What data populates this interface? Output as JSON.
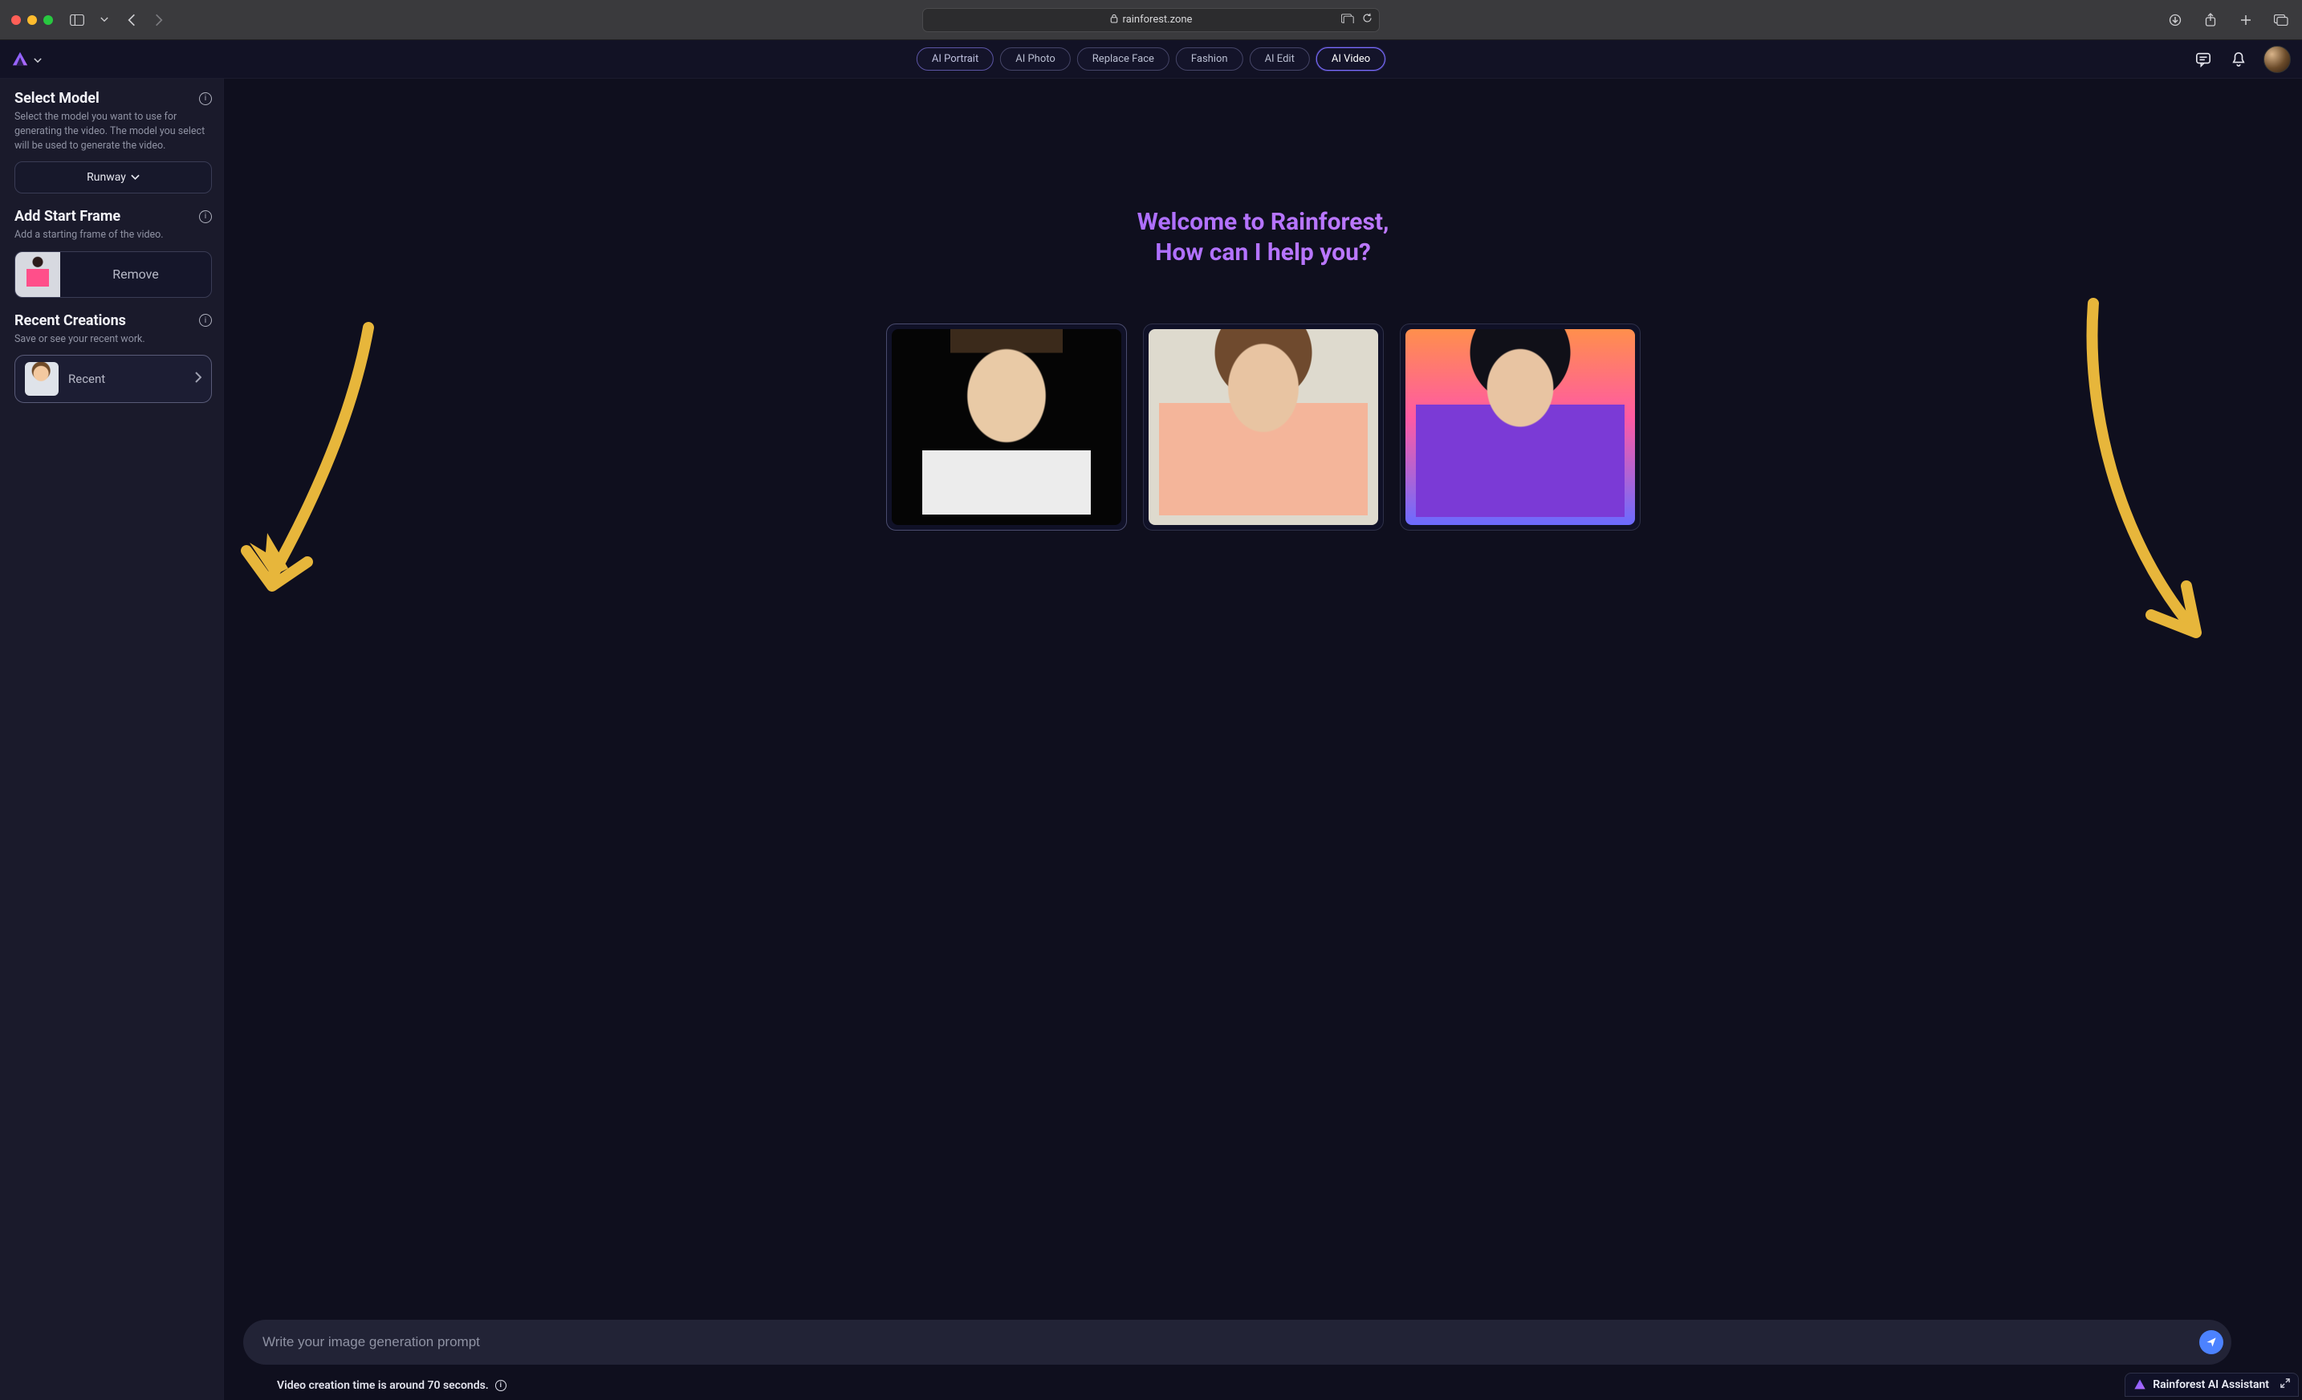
{
  "browser": {
    "url": "rainforest.zone"
  },
  "header": {
    "tabs": [
      {
        "label": "AI Portrait"
      },
      {
        "label": "AI Photo"
      },
      {
        "label": "Replace Face"
      },
      {
        "label": "Fashion"
      },
      {
        "label": "AI Edit"
      },
      {
        "label": "AI Video"
      }
    ],
    "active_tab_index": 5
  },
  "sidebar": {
    "select_model": {
      "title": "Select Model",
      "description": "Select the model you want to use for generating the video. The model you select will be used to generate the video.",
      "value": "Runway"
    },
    "add_start_frame": {
      "title": "Add Start Frame",
      "description": "Add a starting frame of the video.",
      "remove_label": "Remove"
    },
    "recent_creations": {
      "title": "Recent Creations",
      "description": "Save or see your recent work.",
      "item_label": "Recent"
    }
  },
  "canvas": {
    "welcome_line1": "Welcome to Rainforest,",
    "welcome_line2": "How can I help you?"
  },
  "prompt": {
    "placeholder": "Write your image generation prompt"
  },
  "footer": {
    "note": "Video creation time is around 70 seconds."
  },
  "assistant": {
    "label": "Rainforest AI Assistant"
  }
}
